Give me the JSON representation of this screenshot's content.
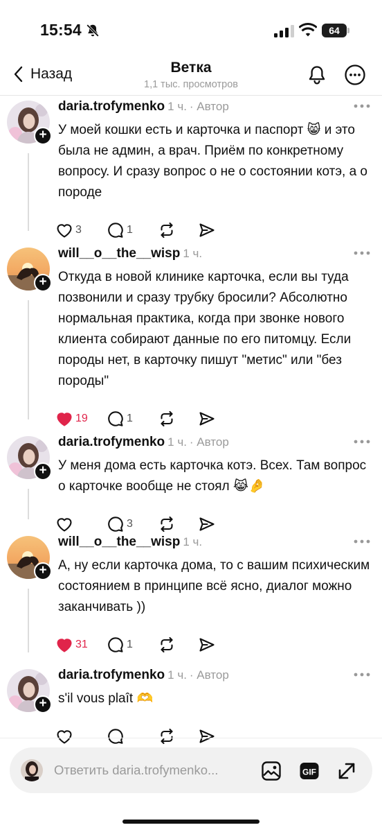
{
  "status_bar": {
    "time": "15:54",
    "battery": "64"
  },
  "header": {
    "back_label": "Назад",
    "title": "Ветка",
    "subtitle": "1,1 тыс. просмотров"
  },
  "posts": [
    {
      "username": "daria.trofymenko",
      "time": "1 ч.",
      "badge": "· Автор",
      "text": "У моей кошки есть и карточка и паспорт 😸 и это была не админ, а врач. Приём по конкретному вопросу. И сразу вопрос о не о состоянии котэ, а о породе",
      "likes": "3",
      "replies": "1",
      "liked": false
    },
    {
      "username": "will__o__the__wisp",
      "time": "1 ч.",
      "badge": "",
      "text": "Откуда в новой клинике карточка, если вы туда позвонили и сразу трубку бросили? Абсолютно нормальная практика, когда при звонке нового клиента собирают данные по его питомцу. Если породы нет, в карточку пишут \"метис\" или \"без породы\"",
      "likes": "19",
      "replies": "1",
      "liked": true
    },
    {
      "username": "daria.trofymenko",
      "time": "1 ч.",
      "badge": "· Автор",
      "text": "У меня дома есть карточка котэ. Всех. Там вопрос о карточке вообще не стоял 😹🤌",
      "likes": "",
      "replies": "3",
      "liked": false
    },
    {
      "username": "will__o__the__wisp",
      "time": "1 ч.",
      "badge": "",
      "text": "А, ну если карточка дома, то с вашим психическим состоянием в принципе всё ясно, диалог можно заканчивать ))",
      "likes": "31",
      "replies": "1",
      "liked": true
    },
    {
      "username": "daria.trofymenko",
      "time": "1 ч.",
      "badge": "· Автор",
      "text": "s'il vous plaît 🫶",
      "likes": "",
      "replies": "",
      "liked": false
    }
  ],
  "reply_bar": {
    "placeholder": "Ответить daria.trofymenko..."
  },
  "icons": {
    "back": "chevron-left-icon",
    "notifications": "bell-icon",
    "more": "more-circle-icon",
    "like": "heart-icon",
    "reply": "comment-icon",
    "repost": "repost-icon",
    "share": "send-icon",
    "attach_image": "image-icon",
    "gif": "gif-icon",
    "expand": "expand-icon"
  },
  "colors": {
    "like_active": "#e0244a",
    "text": "#101010",
    "muted": "#9a9a9a"
  }
}
